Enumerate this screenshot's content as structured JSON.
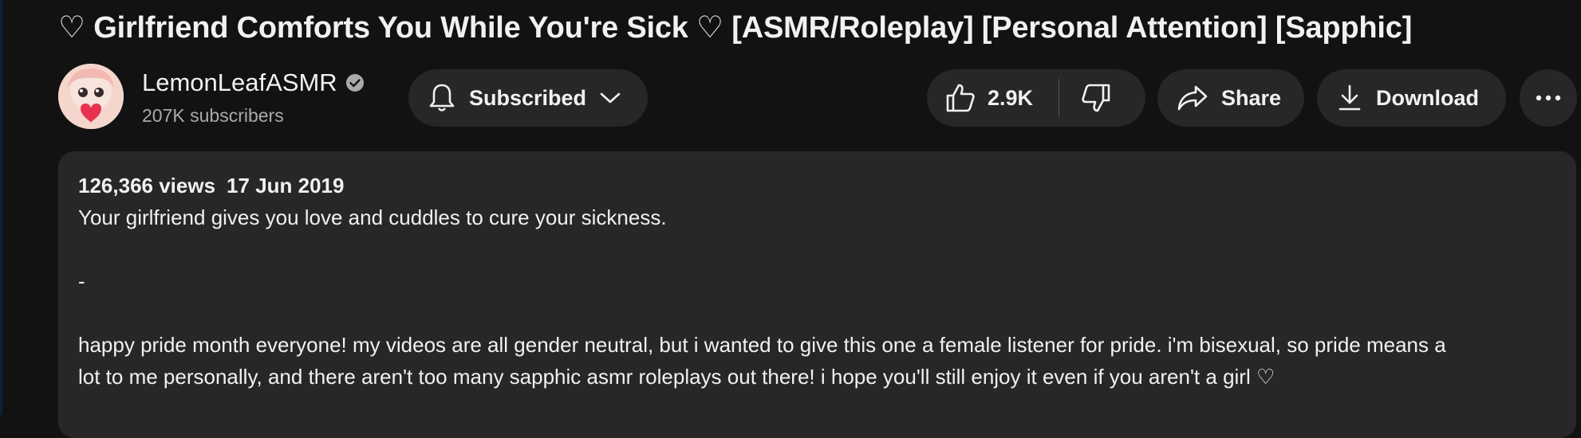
{
  "video": {
    "title": "♡ Girlfriend Comforts You While You're Sick ♡ [ASMR/Roleplay] [Personal Attention] [Sapphic]"
  },
  "channel": {
    "name": "LemonLeafASMR",
    "verified": true,
    "subscribers": "207K subscribers"
  },
  "actions": {
    "subscribe_label": "Subscribed",
    "like_count": "2.9K",
    "share_label": "Share",
    "download_label": "Download"
  },
  "description": {
    "views": "126,366 views",
    "date": "17 Jun 2019",
    "line1": "Your girlfriend gives you love and cuddles to cure your sickness.",
    "line2": "-",
    "line3": "happy pride month everyone! my videos are all gender neutral, but i wanted to give this one a female listener for pride. i'm bisexual, so pride means a",
    "line4": "lot to me personally, and there aren't too many sapphic asmr roleplays out there! i hope you'll still enjoy it even if you aren't a girl ♡"
  },
  "theme": {
    "background": "#121212",
    "surface": "#272727",
    "text": "#f1f1f1",
    "secondary_text": "#aaaaaa"
  },
  "icons": [
    "verified-icon",
    "bell-icon",
    "chevron-down-icon",
    "thumbs-up-icon",
    "thumbs-down-icon",
    "share-icon",
    "download-icon",
    "more-icon"
  ]
}
